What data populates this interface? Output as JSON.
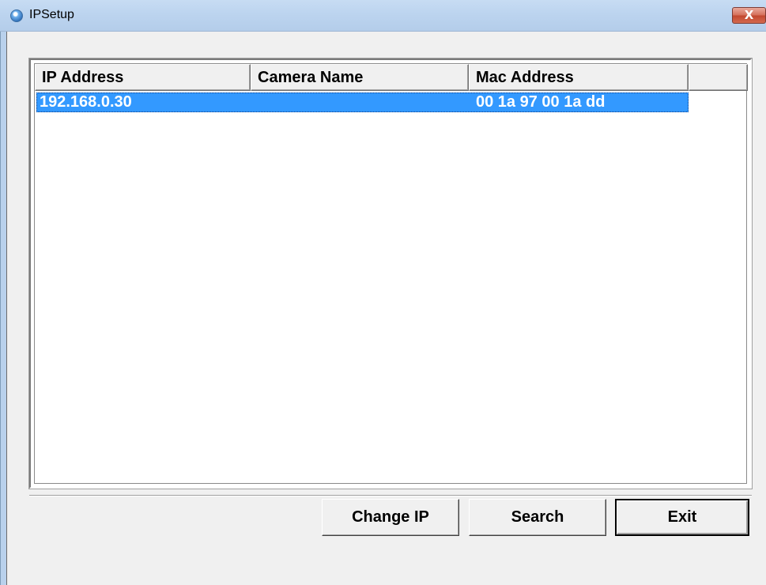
{
  "window": {
    "title": "IPSetup",
    "close_label": "X"
  },
  "table": {
    "columns": [
      "IP Address",
      "Camera Name",
      "Mac Address",
      ""
    ],
    "rows": [
      {
        "ip": "192.168.0.30",
        "camera_name": "",
        "mac": "00 1a 97 00 1a dd"
      }
    ]
  },
  "buttons": {
    "change_ip": "Change IP",
    "search": "Search",
    "exit": "Exit"
  },
  "colors": {
    "selection": "#3399ff",
    "titlebar": "#bcd4ef",
    "close": "#c2472f"
  }
}
